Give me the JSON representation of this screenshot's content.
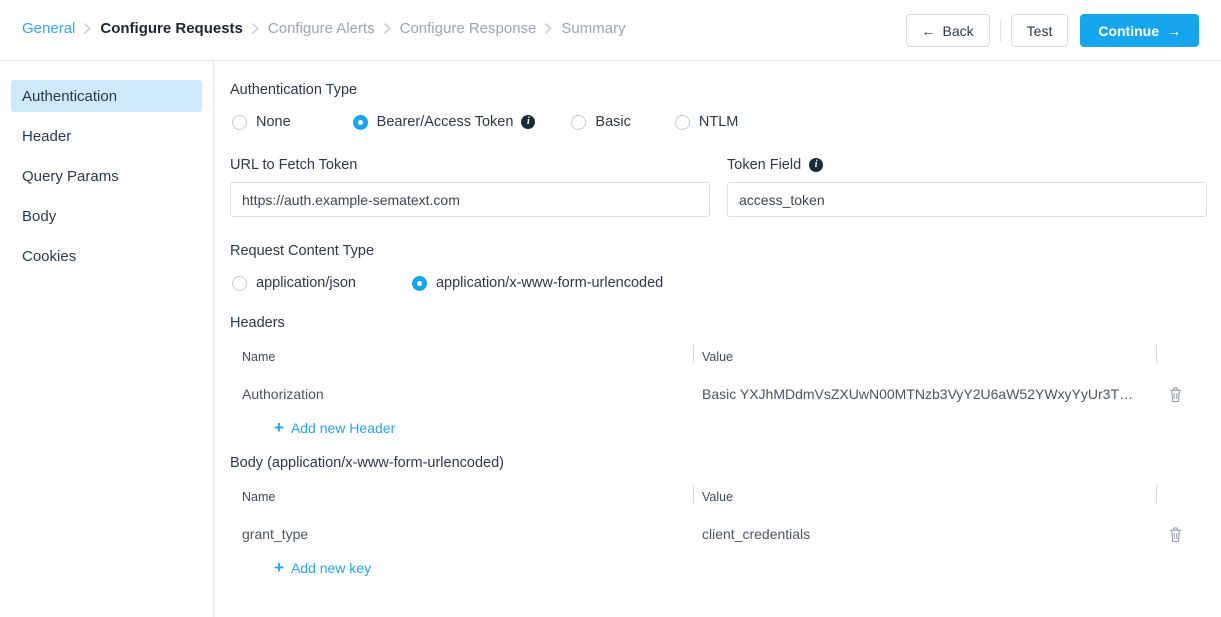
{
  "breadcrumb": {
    "items": [
      {
        "label": "General",
        "state": "link"
      },
      {
        "label": "Configure Requests",
        "state": "current"
      },
      {
        "label": "Configure Alerts",
        "state": "muted"
      },
      {
        "label": "Configure Response",
        "state": "muted"
      },
      {
        "label": "Summary",
        "state": "muted"
      }
    ]
  },
  "topbar": {
    "back_label": "Back",
    "back_arrow": "←",
    "test_label": "Test",
    "continue_label": "Continue",
    "continue_arrow": "→",
    "primary_color": "#16a6ed"
  },
  "sidebar": {
    "items": [
      {
        "label": "Authentication",
        "active": true
      },
      {
        "label": "Header",
        "active": false
      },
      {
        "label": "Query Params",
        "active": false
      },
      {
        "label": "Body",
        "active": false
      },
      {
        "label": "Cookies",
        "active": false
      }
    ],
    "active_bg": "#cfe9fb"
  },
  "main": {
    "auth_type": {
      "label": "Authentication Type",
      "options": [
        {
          "label": "None",
          "selected": false,
          "info": false
        },
        {
          "label": "Bearer/Access Token",
          "selected": true,
          "info": true
        },
        {
          "label": "Basic",
          "selected": false,
          "info": false
        },
        {
          "label": "NTLM",
          "selected": false,
          "info": false
        }
      ]
    },
    "url_field": {
      "label": "URL to Fetch Token",
      "value": "https://auth.example-sematext.com",
      "placeholder": ""
    },
    "token_field": {
      "label": "Token Field",
      "info": true,
      "value": "access_token",
      "placeholder": ""
    },
    "content_type": {
      "label": "Request Content Type",
      "options": [
        {
          "label": "application/json",
          "selected": false
        },
        {
          "label": "application/x-www-form-urlencoded",
          "selected": true
        }
      ]
    },
    "headers_table": {
      "title": "Headers",
      "col_name": "Name",
      "col_value": "Value",
      "rows": [
        {
          "name": "Authorization",
          "value": "Basic YXJhMDdmVsZXUwN00MTNzb3VyY2U6aW52YWxyYyUr3T…"
        }
      ],
      "add_label": "Add new Header"
    },
    "body_table": {
      "title": "Body (application/x-www-form-urlencoded)",
      "col_name": "Name",
      "col_value": "Value",
      "rows": [
        {
          "name": "grant_type",
          "value": "client_credentials"
        }
      ],
      "add_label": "Add new key"
    },
    "link_color": "#28a3f0",
    "icons": {
      "delete": "trash-icon",
      "info": "info-icon",
      "add": "plus-icon"
    }
  }
}
